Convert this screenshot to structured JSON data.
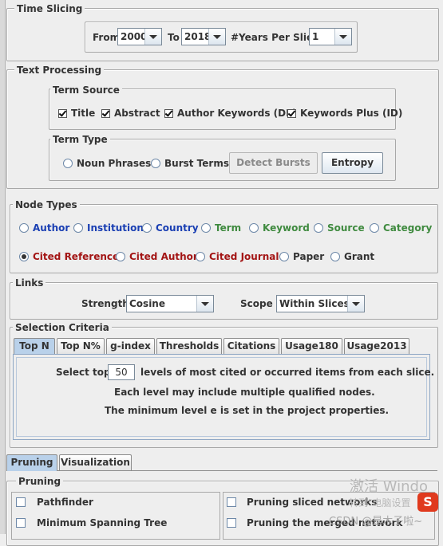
{
  "time_slicing": {
    "legend": "Time Slicing",
    "from_label": "From",
    "from_value": "2000",
    "to_label": "To",
    "to_value": "2018",
    "years_per_slice_label": "#Years Per Slice",
    "years_per_slice_value": "1"
  },
  "text_processing": {
    "legend": "Text Processing",
    "term_source": {
      "legend": "Term Source",
      "items": [
        "Title",
        "Abstract",
        "Author Keywords (DE)",
        "Keywords Plus (ID)"
      ]
    },
    "term_type": {
      "legend": "Term Type",
      "noun_phrases": "Noun Phrases",
      "burst_terms": "Burst Terms",
      "detect_bursts": "Detect Bursts",
      "entropy": "Entropy"
    }
  },
  "node_types": {
    "legend": "Node Types",
    "row1": [
      "Author",
      "Institution",
      "Country",
      "Term",
      "Keyword",
      "Source",
      "Category"
    ],
    "row2": [
      "Cited Reference",
      "Cited Author",
      "Cited Journal",
      "Paper",
      "Grant"
    ],
    "selected": "Cited Reference"
  },
  "links": {
    "legend": "Links",
    "strength_label": "Strength",
    "strength_value": "Cosine",
    "scope_label": "Scope",
    "scope_value": "Within Slices"
  },
  "selection_criteria": {
    "legend": "Selection Criteria",
    "tabs": [
      "Top N",
      "Top N%",
      "g-index",
      "Thresholds",
      "Citations",
      "Usage180",
      "Usage2013"
    ],
    "active_tab": "Top N",
    "select_top_label": "Select top",
    "select_top_value": "50",
    "levels_text": "levels of most cited or occurred items from each slice.",
    "note1": "Each level may include multiple qualified nodes.",
    "note2": "The minimum level e is set in the project properties."
  },
  "bottom_tabs": {
    "tabs": [
      "Pruning",
      "Visualization"
    ],
    "active": "Pruning"
  },
  "pruning": {
    "legend": "Pruning",
    "pathfinder": "Pathfinder",
    "mst": "Minimum Spanning Tree",
    "pruning_sliced": "Pruning sliced networks",
    "pruning_merged": "Pruning the merged network"
  },
  "watermarks": {
    "activate": "激活 Windo",
    "activate_sub": "转到\"电脑设置",
    "csdn": "CSDN @是木子啦~"
  },
  "colors": {
    "background": "#eeeeee",
    "tab_active": "#b9d1ea",
    "blue": "#1a3fb3",
    "green": "#3f8a3f",
    "red": "#a31515"
  }
}
